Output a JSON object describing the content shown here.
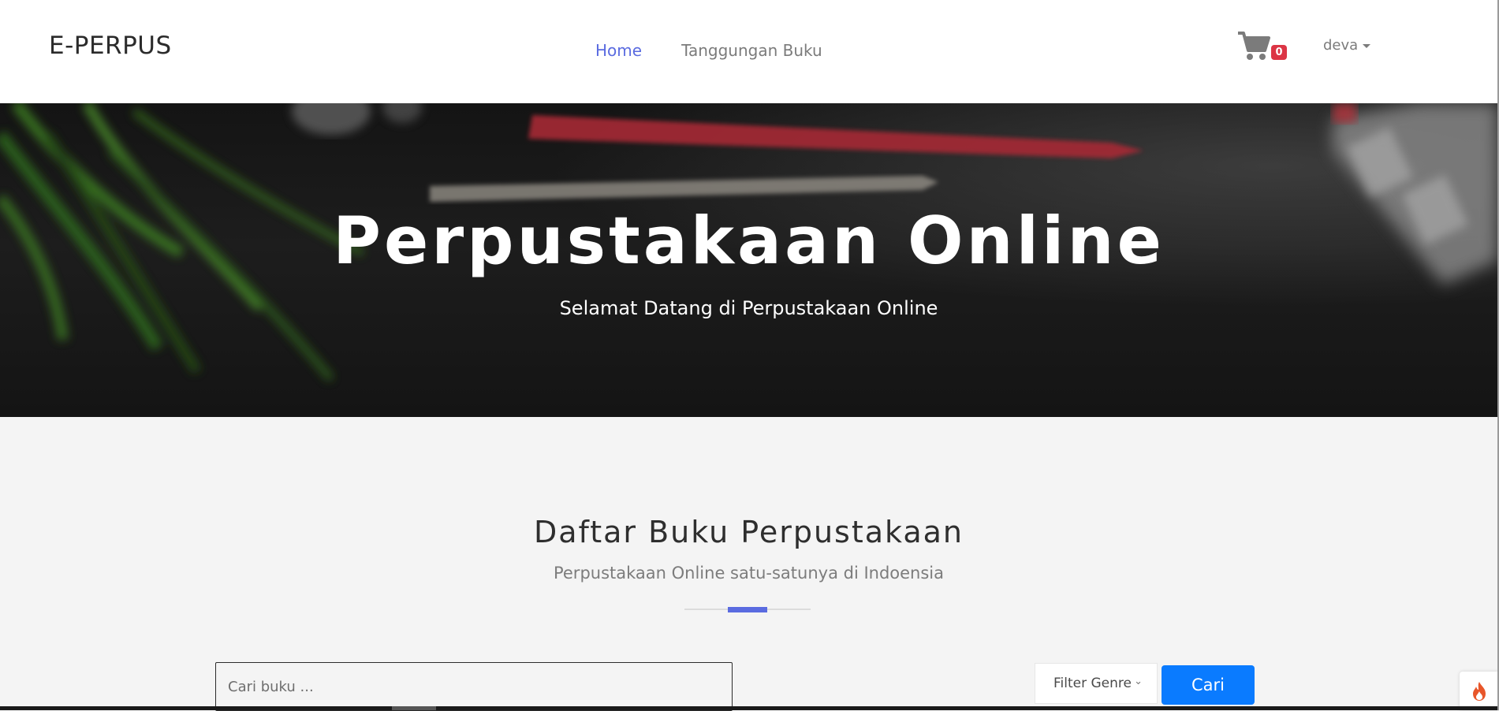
{
  "navbar": {
    "brand": "E-PERPUS",
    "links": [
      {
        "label": "Home",
        "active": true
      },
      {
        "label": "Tanggungan Buku",
        "active": false
      }
    ],
    "cart": {
      "icon": "cart-icon",
      "count": "0"
    },
    "user": {
      "name": "deva",
      "icon": "caret-down-icon"
    }
  },
  "hero": {
    "title": "Perpustakaan Online",
    "subtitle": "Selamat Datang di Perpustakaan Online"
  },
  "section": {
    "title": "Daftar Buku Perpustakaan",
    "subtitle": "Perpustakaan Online satu-satunya di Indoensia"
  },
  "search": {
    "placeholder": "Cari buku ...",
    "genre_label": "Filter Genre",
    "button_label": "Cari"
  },
  "floating": {
    "icon": "flame-icon"
  },
  "colors": {
    "accent": "#5a6be0",
    "primary_button": "#0a7bff",
    "badge": "#dc3545",
    "flame": "#e8562a"
  }
}
